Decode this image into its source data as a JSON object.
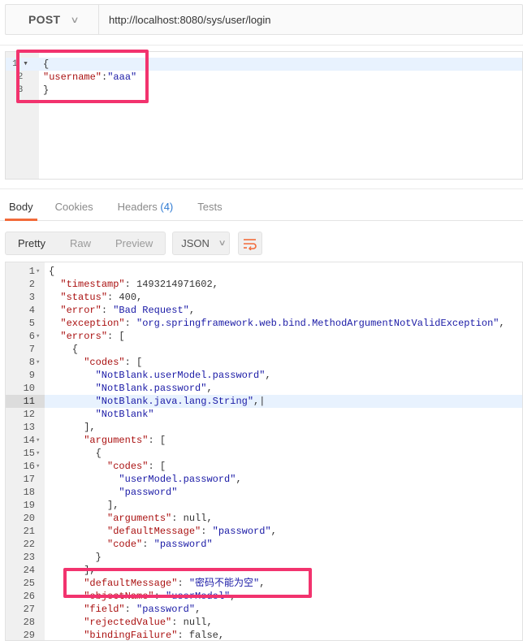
{
  "request": {
    "method": "POST",
    "url": "http://localhost:8080/sys/user/login",
    "body_lines": [
      {
        "n": "1",
        "fold": "▾",
        "code": "{"
      },
      {
        "n": "2",
        "fold": "",
        "code": "\"username\":\"aaa\""
      },
      {
        "n": "3",
        "fold": "",
        "code": "}"
      }
    ]
  },
  "tabs": {
    "body": "Body",
    "cookies": "Cookies",
    "headers": "Headers",
    "headers_count": "(4)",
    "tests": "Tests"
  },
  "toolbar": {
    "pretty": "Pretty",
    "raw": "Raw",
    "preview": "Preview",
    "format": "JSON",
    "wrap_icon": "wrap-lines-icon"
  },
  "response_lines": [
    {
      "n": "1",
      "fold": "▾",
      "code": "{"
    },
    {
      "n": "2",
      "fold": "",
      "code": "  \"timestamp\": 1493214971602,"
    },
    {
      "n": "3",
      "fold": "",
      "code": "  \"status\": 400,"
    },
    {
      "n": "4",
      "fold": "",
      "code": "  \"error\": \"Bad Request\","
    },
    {
      "n": "5",
      "fold": "",
      "code": "  \"exception\": \"org.springframework.web.bind.MethodArgumentNotValidException\","
    },
    {
      "n": "6",
      "fold": "▾",
      "code": "  \"errors\": ["
    },
    {
      "n": "7",
      "fold": "",
      "code": "    {"
    },
    {
      "n": "8",
      "fold": "▾",
      "code": "      \"codes\": ["
    },
    {
      "n": "9",
      "fold": "",
      "code": "        \"NotBlank.userModel.password\","
    },
    {
      "n": "10",
      "fold": "",
      "code": "        \"NotBlank.password\","
    },
    {
      "n": "11",
      "fold": "",
      "code": "        \"NotBlank.java.lang.String\",|"
    },
    {
      "n": "12",
      "fold": "",
      "code": "        \"NotBlank\""
    },
    {
      "n": "13",
      "fold": "",
      "code": "      ],"
    },
    {
      "n": "14",
      "fold": "▾",
      "code": "      \"arguments\": ["
    },
    {
      "n": "15",
      "fold": "▾",
      "code": "        {"
    },
    {
      "n": "16",
      "fold": "▾",
      "code": "          \"codes\": ["
    },
    {
      "n": "17",
      "fold": "",
      "code": "            \"userModel.password\","
    },
    {
      "n": "18",
      "fold": "",
      "code": "            \"password\""
    },
    {
      "n": "19",
      "fold": "",
      "code": "          ],"
    },
    {
      "n": "20",
      "fold": "",
      "code": "          \"arguments\": null,"
    },
    {
      "n": "21",
      "fold": "",
      "code": "          \"defaultMessage\": \"password\","
    },
    {
      "n": "22",
      "fold": "",
      "code": "          \"code\": \"password\""
    },
    {
      "n": "23",
      "fold": "",
      "code": "        }"
    },
    {
      "n": "24",
      "fold": "",
      "code": "      ],"
    },
    {
      "n": "25",
      "fold": "",
      "code": "      \"defaultMessage\": \"密码不能为空\","
    },
    {
      "n": "26",
      "fold": "",
      "code": "      \"objectName\": \"userModel\","
    },
    {
      "n": "27",
      "fold": "",
      "code": "      \"field\": \"password\","
    },
    {
      "n": "28",
      "fold": "",
      "code": "      \"rejectedValue\": null,"
    },
    {
      "n": "29",
      "fold": "",
      "code": "      \"bindingFailure\": false,"
    }
  ],
  "colors": {
    "highlight": "#f2336e",
    "tab_accent": "#f26b3a",
    "string": "#1a1aa6",
    "key": "#a11"
  }
}
